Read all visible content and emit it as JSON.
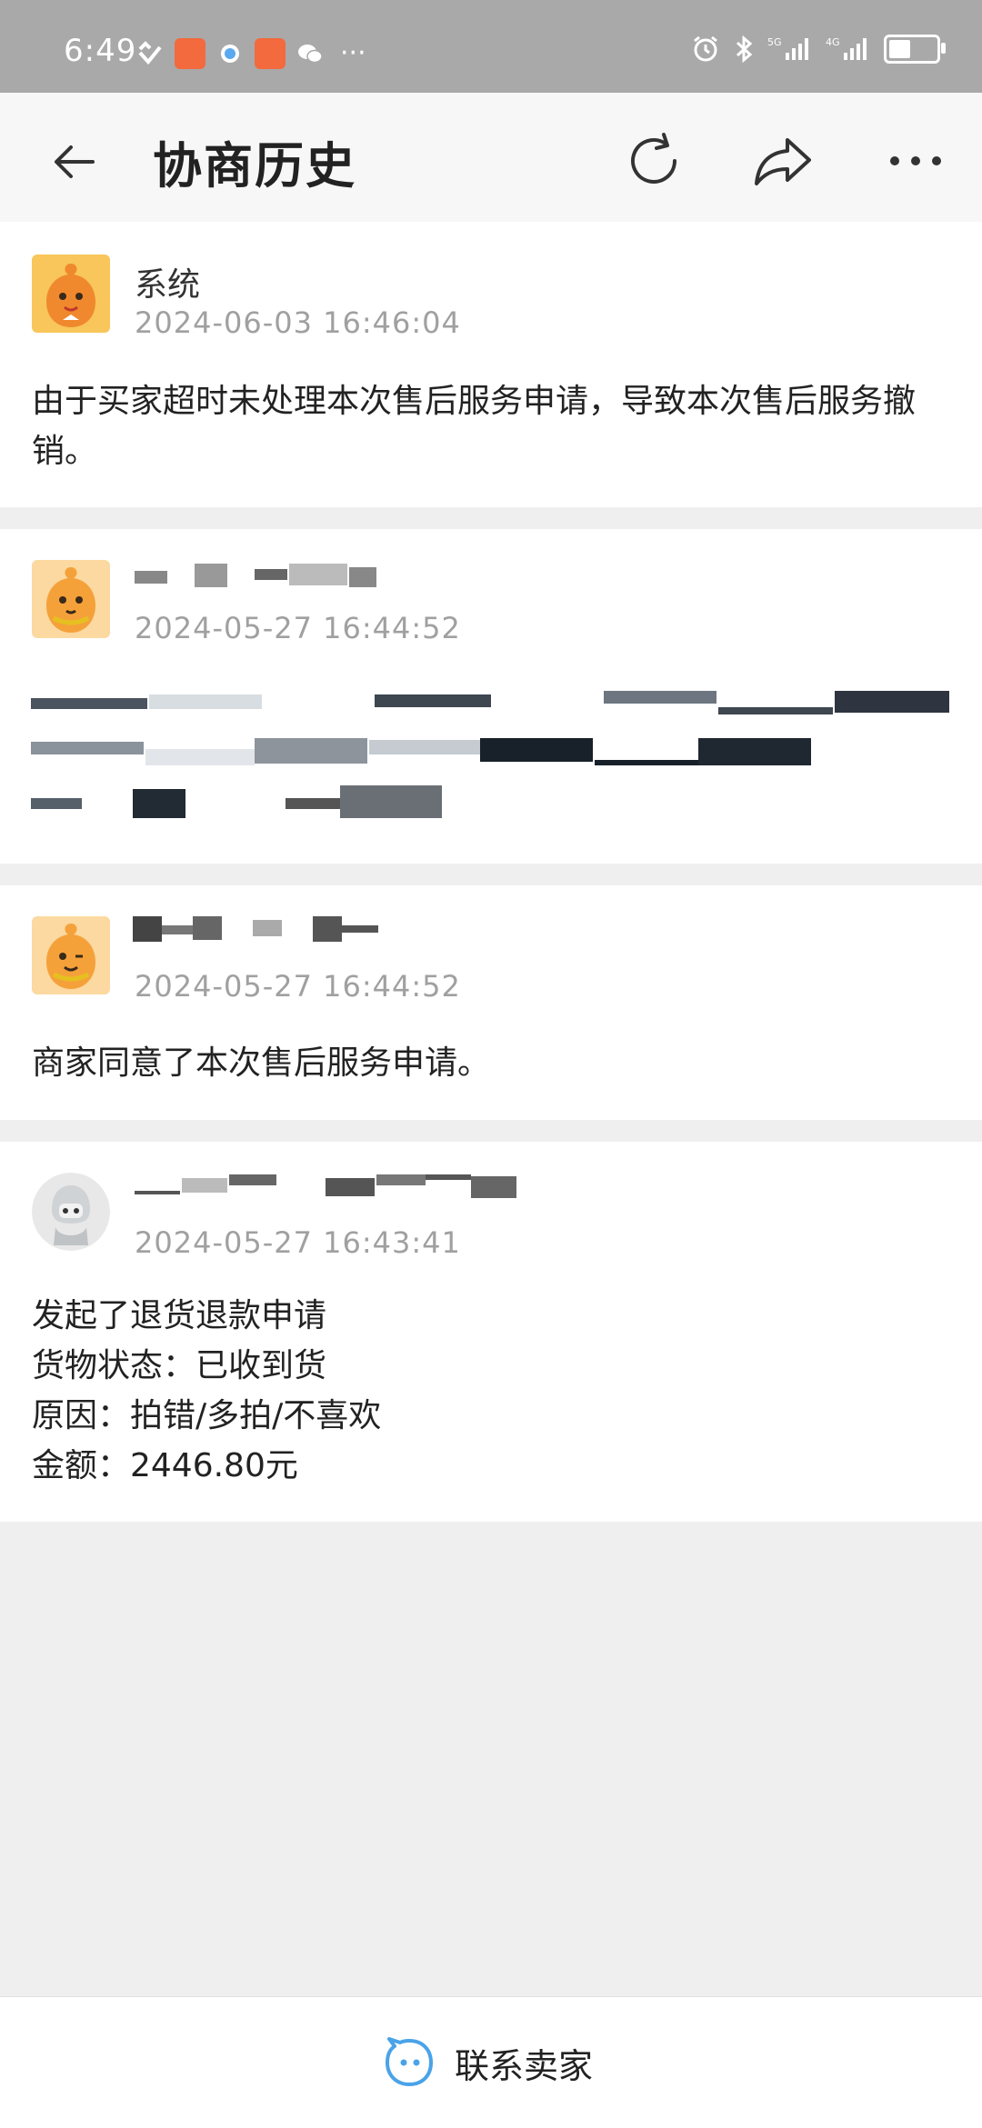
{
  "status_bar": {
    "time": "6:49",
    "more": "···",
    "battery_level": 0.45
  },
  "header": {
    "title": "协商历史",
    "back_icon": "back-arrow-icon",
    "refresh_icon": "refresh-icon",
    "share_icon": "share-icon",
    "more_icon": "more-icon"
  },
  "records": [
    {
      "name": "系统",
      "time": "2024-06-03 16:46:04",
      "lines": [
        "由于买家超时未处理本次售后服务申请，导致本次售后服务撤",
        "销。"
      ]
    },
    {
      "name": "",
      "time": "2024-05-27 16:44:52",
      "lines": []
    },
    {
      "name": "",
      "time": "2024-05-27 16:44:52",
      "lines": [
        "商家同意了本次售后服务申请。"
      ]
    },
    {
      "name": "",
      "time": "2024-05-27 16:43:41",
      "lines": [
        "发起了退货退款申请",
        "货物状态：已收到货",
        "原因：拍错/多拍/不喜欢",
        "金额：2446.80元"
      ]
    }
  ],
  "bottom_bar": {
    "contact_label": "联系卖家",
    "contact_icon": "chat-bubble-icon"
  },
  "colors": {
    "status_bar_bg": "#a9a9a9",
    "avatar_orange": "#f5a13a",
    "text_gray": "#a0a0a0",
    "accent_blue": "#4aa3e8"
  }
}
